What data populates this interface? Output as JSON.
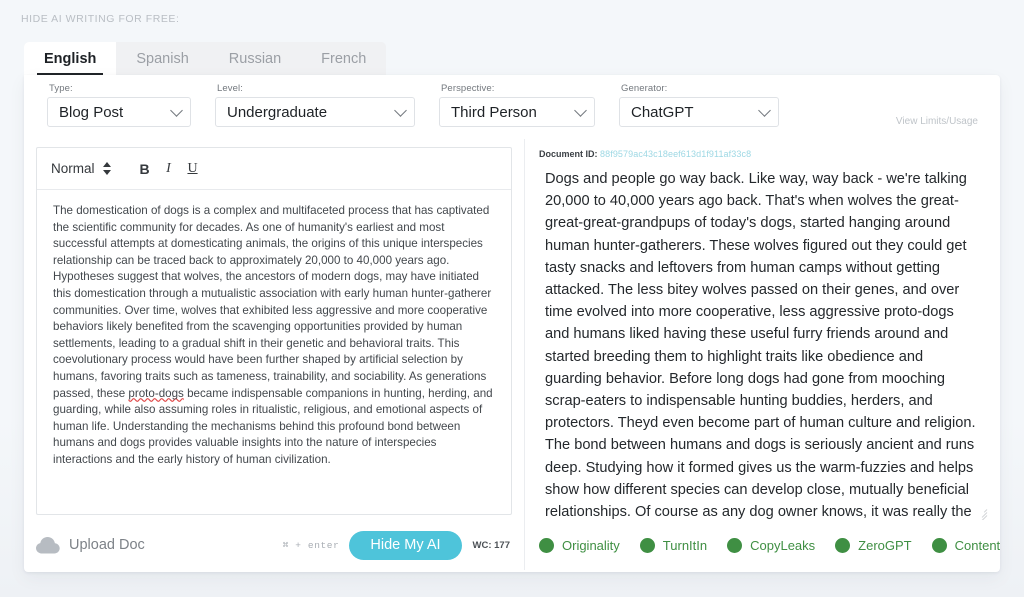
{
  "header": {
    "eyebrow": "HIDE AI WRITING FOR FREE:"
  },
  "tabs": [
    {
      "label": "English",
      "active": true
    },
    {
      "label": "Spanish",
      "active": false
    },
    {
      "label": "Russian",
      "active": false
    },
    {
      "label": "French",
      "active": false
    }
  ],
  "controls": {
    "type": {
      "label": "Type:",
      "value": "Blog Post"
    },
    "level": {
      "label": "Level:",
      "value": "Undergraduate"
    },
    "perspective": {
      "label": "Perspective:",
      "value": "Third Person"
    },
    "generator": {
      "label": "Generator:",
      "value": "ChatGPT"
    },
    "view_limits": "View Limits/Usage"
  },
  "editor": {
    "toolbar": {
      "style": "Normal",
      "bold": "B",
      "italic": "I",
      "underline": "U"
    },
    "text_part1": "The domestication of dogs is a complex and multifaceted process that has captivated the scientific community for decades. As one of humanity's earliest and most successful attempts at domesticating animals, the origins of this unique interspecies relationship can be traced back to approximately 20,000 to 40,000 years ago. Hypotheses suggest that wolves, the ancestors of modern dogs, may have initiated this domestication through a mutualistic association with early human hunter-gatherer communities. Over time, wolves that exhibited less aggressive and more cooperative behaviors likely benefited from the scavenging opportunities provided by human settlements, leading to a gradual shift in their genetic and behavioral traits. This coevolutionary process would have been further shaped by artificial selection by humans, favoring traits such as tameness, trainability, and sociability. As generations passed, these ",
    "text_misspelled": "proto-dogs",
    "text_part2": " became indispensable companions in hunting, herding, and guarding, while also assuming roles in ritualistic, religious, and emotional aspects of human life. Understanding the mechanisms behind this profound bond between humans and dogs provides valuable insights into the nature of interspecies interactions and the early history of human civilization.",
    "footer": {
      "upload_label": "Upload Doc",
      "shortcut": "⌘ + enter",
      "hide_button": "Hide My AI",
      "word_count": "WC: 177"
    }
  },
  "output": {
    "doc_id_label": "Document ID:",
    "doc_id_value": "88f9579ac43c18eef613d1f911af33c8",
    "text": "Dogs and people go way back.  Like way, way back - we're talking 20,000 to 40,000 years ago back.  That's when wolves the great-great-great-grandpups of today's dogs, started hanging around human hunter-gatherers.  These wolves figured out they could get tasty snacks and leftovers from human camps without getting attacked.  The less bitey wolves passed on their genes, and over time evolved into more cooperative, less aggressive proto-dogs and  humans liked having these useful furry friends around and started breeding them to highlight traits like obedience and guarding behavior.  Before long dogs had gone from mooching scrap-eaters to indispensable hunting buddies, herders, and protectors.  Theyd even become part of human culture and religion.  The bond between humans and dogs is seriously ancient and runs deep.  Studying how it formed gives us the warm-fuzzies and helps show how different species can develop close, mutually beneficial relationships.  Of course as any dog owner knows, it was really the proto-puppers that domesticated us."
  },
  "detectors": [
    {
      "label": "Originality"
    },
    {
      "label": "TurnItIn"
    },
    {
      "label": "CopyLeaks"
    },
    {
      "label": "ZeroGPT"
    },
    {
      "label": "ContentScale"
    }
  ],
  "colors": {
    "accent_teal": "#4ec4da",
    "detector_green": "#3f8f43",
    "doc_id_hash": "#9ed8e4",
    "spellcheck_red": "#e04a4a"
  }
}
